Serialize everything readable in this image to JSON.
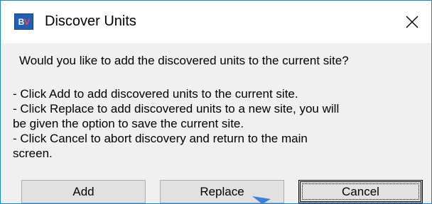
{
  "window": {
    "title": "Discover Units",
    "app_icon_text": "BV",
    "close_icon": "close-icon"
  },
  "message": {
    "question": "Would you like to add the discovered units to the current site?",
    "lines": [
      "- Click Add to add discovered units to the current site.",
      "- Click Replace to add discovered units to a new site, you will",
      "be given the option to save the current site.",
      "- Click Cancel to abort discovery and return to the main",
      "screen."
    ]
  },
  "buttons": {
    "add": "Add",
    "replace": "Replace",
    "cancel": "Cancel"
  },
  "colors": {
    "border": "#1883d7",
    "content_bg": "#f0f0f0",
    "button_bg": "#e1e1e1",
    "icon_bg": "#1f5fb8"
  }
}
